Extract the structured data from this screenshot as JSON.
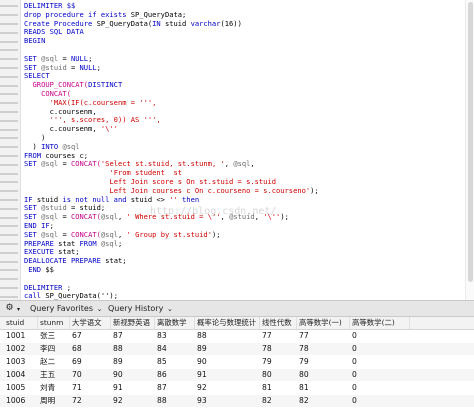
{
  "editor": {
    "watermark": "http://blog.csdn.net/",
    "lines": [
      [
        {
          "t": "DELIMITER $$",
          "c": "kw"
        }
      ],
      [
        {
          "t": "drop procedure if exists ",
          "c": "kw"
        },
        {
          "t": "SP_QueryData;",
          "c": ""
        }
      ],
      [
        {
          "t": "Create Procedure ",
          "c": "kw"
        },
        {
          "t": "SP_QueryData(",
          "c": ""
        },
        {
          "t": "IN ",
          "c": "kw"
        },
        {
          "t": "stuid ",
          "c": ""
        },
        {
          "t": "varchar",
          "c": "kw"
        },
        {
          "t": "(16))",
          "c": ""
        }
      ],
      [
        {
          "t": "READS SQL DATA",
          "c": "kw"
        }
      ],
      [
        {
          "t": "BEGIN",
          "c": "kw"
        }
      ],
      [
        {
          "t": "",
          "c": ""
        }
      ],
      [
        {
          "t": "SET ",
          "c": "kw"
        },
        {
          "t": "@sql",
          "c": "var"
        },
        {
          "t": " = ",
          "c": ""
        },
        {
          "t": "NULL",
          "c": "kw"
        },
        {
          "t": ";",
          "c": ""
        }
      ],
      [
        {
          "t": "SET ",
          "c": "kw"
        },
        {
          "t": "@stuid",
          "c": "var"
        },
        {
          "t": " = ",
          "c": ""
        },
        {
          "t": "NULL",
          "c": "kw"
        },
        {
          "t": ";",
          "c": ""
        }
      ],
      [
        {
          "t": "SELECT",
          "c": "kw"
        }
      ],
      [
        {
          "t": "  GROUP_CONCAT(",
          "c": "fn"
        },
        {
          "t": "DISTINCT",
          "c": "kw"
        }
      ],
      [
        {
          "t": "    CONCAT(",
          "c": "fn"
        }
      ],
      [
        {
          "t": "      'MAX(IF(c.coursenm = ''',",
          "c": "str"
        }
      ],
      [
        {
          "t": "      c.coursenm,",
          "c": ""
        }
      ],
      [
        {
          "t": "      ''', s.scores, 0)) AS ''',",
          "c": "str"
        }
      ],
      [
        {
          "t": "      c.coursenm, ",
          "c": ""
        },
        {
          "t": "'\\''",
          "c": "str"
        }
      ],
      [
        {
          "t": "    )",
          "c": ""
        }
      ],
      [
        {
          "t": "  ) ",
          "c": ""
        },
        {
          "t": "INTO ",
          "c": "kw"
        },
        {
          "t": "@sql",
          "c": "var"
        }
      ],
      [
        {
          "t": "FROM ",
          "c": "kw"
        },
        {
          "t": "courses c;",
          "c": ""
        }
      ],
      [
        {
          "t": "SET ",
          "c": "kw"
        },
        {
          "t": "@sql",
          "c": "var"
        },
        {
          "t": " = ",
          "c": ""
        },
        {
          "t": "CONCAT(",
          "c": "fn"
        },
        {
          "t": "'Select st.stuid, st.stunm, '",
          "c": "str"
        },
        {
          "t": ", ",
          "c": ""
        },
        {
          "t": "@sql",
          "c": "var"
        },
        {
          "t": ",",
          "c": ""
        }
      ],
      [
        {
          "t": "                    ",
          "c": ""
        },
        {
          "t": "'From student  st",
          "c": "str"
        }
      ],
      [
        {
          "t": "                    ",
          "c": ""
        },
        {
          "t": "Left Join score s On st.stuid = s.stuid",
          "c": "str"
        }
      ],
      [
        {
          "t": "                    ",
          "c": ""
        },
        {
          "t": "Left Join courses c On c.courseno = s.courseno'",
          "c": "str"
        },
        {
          "t": ");",
          "c": ""
        }
      ],
      [
        {
          "t": "IF ",
          "c": "kw"
        },
        {
          "t": "stuid ",
          "c": ""
        },
        {
          "t": "is not null and ",
          "c": "kw"
        },
        {
          "t": "stuid <> ",
          "c": ""
        },
        {
          "t": "''",
          "c": "str"
        },
        {
          "t": " then",
          "c": "kw"
        }
      ],
      [
        {
          "t": "SET ",
          "c": "kw"
        },
        {
          "t": "@stuid",
          "c": "var"
        },
        {
          "t": " = stuid;",
          "c": ""
        }
      ],
      [
        {
          "t": "SET ",
          "c": "kw"
        },
        {
          "t": "@sql",
          "c": "var"
        },
        {
          "t": " = ",
          "c": ""
        },
        {
          "t": "CONCAT(",
          "c": "fn"
        },
        {
          "t": "@sql",
          "c": "var"
        },
        {
          "t": ", ",
          "c": ""
        },
        {
          "t": "' Where st.stuid = \\''",
          "c": "str"
        },
        {
          "t": ", ",
          "c": ""
        },
        {
          "t": "@stuid",
          "c": "var"
        },
        {
          "t": ", ",
          "c": ""
        },
        {
          "t": "'\\''",
          "c": "str"
        },
        {
          "t": ");",
          "c": ""
        }
      ],
      [
        {
          "t": "END IF",
          "c": "kw"
        },
        {
          "t": ";",
          "c": ""
        }
      ],
      [
        {
          "t": "SET ",
          "c": "kw"
        },
        {
          "t": "@sql",
          "c": "var"
        },
        {
          "t": " = ",
          "c": ""
        },
        {
          "t": "CONCAT(",
          "c": "fn"
        },
        {
          "t": "@sql",
          "c": "var"
        },
        {
          "t": ", ",
          "c": ""
        },
        {
          "t": "' Group by st.stuid'",
          "c": "str"
        },
        {
          "t": ");",
          "c": ""
        }
      ],
      [
        {
          "t": "PREPARE ",
          "c": "kw"
        },
        {
          "t": "stat ",
          "c": ""
        },
        {
          "t": "FROM ",
          "c": "kw"
        },
        {
          "t": "@sql",
          "c": "var"
        },
        {
          "t": ";",
          "c": ""
        }
      ],
      [
        {
          "t": "EXECUTE ",
          "c": "kw"
        },
        {
          "t": "stat;",
          "c": ""
        }
      ],
      [
        {
          "t": "DEALLOCATE PREPARE ",
          "c": "kw"
        },
        {
          "t": "stat;",
          "c": ""
        }
      ],
      [
        {
          "t": " END ",
          "c": "kw"
        },
        {
          "t": "$$",
          "c": ""
        }
      ],
      [
        {
          "t": "",
          "c": ""
        }
      ],
      [
        {
          "t": "DELIMITER ",
          "c": "kw"
        },
        {
          "t": ";",
          "c": ""
        }
      ],
      [
        {
          "t": "call ",
          "c": "kw"
        },
        {
          "t": "SP_QueryData('');",
          "c": ""
        }
      ]
    ]
  },
  "toolbar": {
    "gear_icon": "gear-icon",
    "favorites_label": "Query Favorites",
    "history_label": "Query History"
  },
  "results": {
    "columns": [
      "stuid",
      "stunm",
      "大学语文",
      "新视野英语",
      "离散数学",
      "概率论与数理统计",
      "线性代数",
      "高等数学(一)",
      "高等数学(二)"
    ],
    "rows": [
      [
        "1001",
        "张三",
        "67",
        "87",
        "83",
        "88",
        "77",
        "77",
        "0"
      ],
      [
        "1002",
        "李四",
        "68",
        "88",
        "84",
        "89",
        "78",
        "78",
        "0"
      ],
      [
        "1003",
        "赵二",
        "69",
        "89",
        "85",
        "90",
        "79",
        "79",
        "0"
      ],
      [
        "1004",
        "王五",
        "70",
        "90",
        "86",
        "91",
        "80",
        "80",
        "0"
      ],
      [
        "1005",
        "刘青",
        "71",
        "91",
        "87",
        "92",
        "81",
        "81",
        "0"
      ],
      [
        "1006",
        "周明",
        "72",
        "92",
        "88",
        "93",
        "82",
        "82",
        "0"
      ]
    ]
  }
}
